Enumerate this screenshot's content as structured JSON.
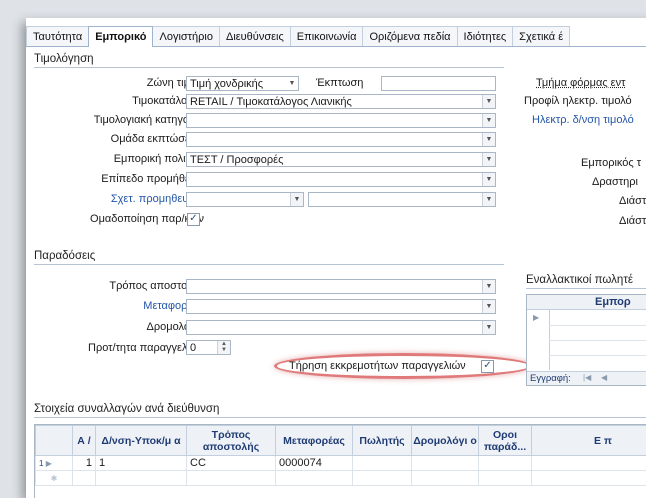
{
  "tabs": [
    "Ταυτότητα",
    "Εμπορικό",
    "Λογιστήριο",
    "Διευθύνσεις",
    "Επικοινωνία",
    "Οριζόμενα πεδία",
    "Ιδιότητες",
    "Σχετικά έ"
  ],
  "pricing": {
    "title": "Τιμολόγηση",
    "price_zone_label": "Ζώνη τιμών",
    "price_zone_value": "Τιμή χονδρικής",
    "discount_label": "Έκπτωση",
    "discount_value": "",
    "price_list_label": "Τιμοκατάλογος",
    "price_list_value": "RETAIL / Τιμοκατάλογος Λιανικής",
    "invoice_category_label": "Τιμολογιακή κατηγορία",
    "discount_group_label": "Ομάδα εκπτώσεων",
    "commercial_policy_label": "Εμπορική πολιτική",
    "commercial_policy_value": "ΤΕΣΤ / Προσφορές",
    "commission_level_label": "Επίπεδο προμήθειας",
    "related_commission_label": "Σχετ. προμηθευτής",
    "item_grouping_label": "Ομαδοποίηση παρ/κών",
    "item_grouping_checked": "✓",
    "right_form_section_label": "Τμήμα φόρμας εντ",
    "right_e_invoice_profile_label": "Προφίλ ηλεκτρ. τιμολό",
    "right_e_invoice_address_label": "Ηλεκτρ. δ/νση τιμολό",
    "right_commercial_label": "Εμπορικός τ",
    "right_activity_label": "Δραστηρι",
    "right_dim1_label": "Διάστ",
    "right_dim2_label": "Διάστ"
  },
  "deliveries": {
    "title": "Παραδόσεις",
    "shipping_method_label": "Τρόπος αποστολής",
    "carrier_label": "Μεταφορέας",
    "route_label": "Δρομολόγιο",
    "order_priority_label": "Προτ/τητα παραγγελιών",
    "order_priority_value": "0",
    "keep_backorders_label": "Τήρηση εκκρεμοτήτων παραγγελιών",
    "keep_backorders_checked": "✓"
  },
  "alt_sellers": {
    "title": "Εναλλακτικοί πωλητέ",
    "col_header": "Εμπορ",
    "record_label": "Εγγραφή:"
  },
  "transactions": {
    "title": "Στοιχεία συναλλαγών ανά διεύθυνση",
    "columns": [
      "Α / ",
      "Δ/νση-Υποκ/μ α",
      "Τρόπος αποστολής",
      "Μεταφορέας",
      "Πωλητής",
      "Δρομολόγι ο",
      "Οροι παράδ...",
      "Ε π"
    ],
    "rows": [
      {
        "rownum": "1",
        "a": "1",
        "address": "1",
        "shipping": "CC",
        "carrier": "0000074",
        "seller": "",
        "route": "",
        "terms": ""
      }
    ]
  },
  "icons": {
    "dropdown": "chevron-down-icon",
    "spinner": "spinner-icon",
    "row_pointer": "row-pointer-icon"
  }
}
